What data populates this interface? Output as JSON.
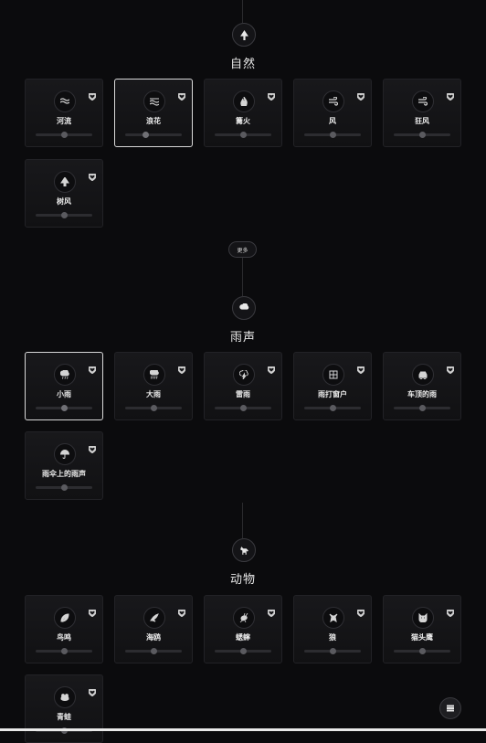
{
  "sections": [
    {
      "title": "自然",
      "icon": "tree-icon",
      "cards": [
        {
          "label": "河流",
          "icon": "waves-icon",
          "volume": 0.5,
          "active": false
        },
        {
          "label": "浪花",
          "icon": "surf-icon",
          "volume": 0.35,
          "active": true
        },
        {
          "label": "篝火",
          "icon": "fire-icon",
          "volume": 0.5,
          "active": false
        },
        {
          "label": "风",
          "icon": "wind-icon",
          "volume": 0.5,
          "active": false
        },
        {
          "label": "狂风",
          "icon": "wind-icon",
          "volume": 0.5,
          "active": false
        },
        {
          "label": "树风",
          "icon": "tree-icon",
          "volume": 0.5,
          "active": false
        }
      ]
    },
    {
      "title": "雨声",
      "icon": "cloud-rain-icon",
      "cards": [
        {
          "label": "小雨",
          "icon": "cloud-rain-icon",
          "volume": 0.5,
          "active": true
        },
        {
          "label": "大雨",
          "icon": "cloud-heavy-rain-icon",
          "volume": 0.5,
          "active": false
        },
        {
          "label": "雷雨",
          "icon": "cloud-lightning-icon",
          "volume": 0.5,
          "active": false
        },
        {
          "label": "雨打窗户",
          "icon": "window-icon",
          "volume": 0.5,
          "active": false
        },
        {
          "label": "车顶的雨",
          "icon": "car-icon",
          "volume": 0.5,
          "active": false
        },
        {
          "label": "雨伞上的雨声",
          "icon": "umbrella-icon",
          "volume": 0.5,
          "active": false
        }
      ]
    },
    {
      "title": "动物",
      "icon": "dog-icon",
      "cards": [
        {
          "label": "鸟鸣",
          "icon": "feather-icon",
          "volume": 0.5,
          "active": false
        },
        {
          "label": "海鸥",
          "icon": "bird-icon",
          "volume": 0.5,
          "active": false
        },
        {
          "label": "蟋蟀",
          "icon": "cricket-icon",
          "volume": 0.5,
          "active": false
        },
        {
          "label": "狼",
          "icon": "wolf-icon",
          "volume": 0.5,
          "active": false
        },
        {
          "label": "猫头鹰",
          "icon": "owl-icon",
          "volume": 0.5,
          "active": false
        },
        {
          "label": "青蛙",
          "icon": "frog-icon",
          "volume": 0.5,
          "active": false
        }
      ]
    }
  ],
  "more_button": "更多",
  "menu_icon": "menu-icon"
}
